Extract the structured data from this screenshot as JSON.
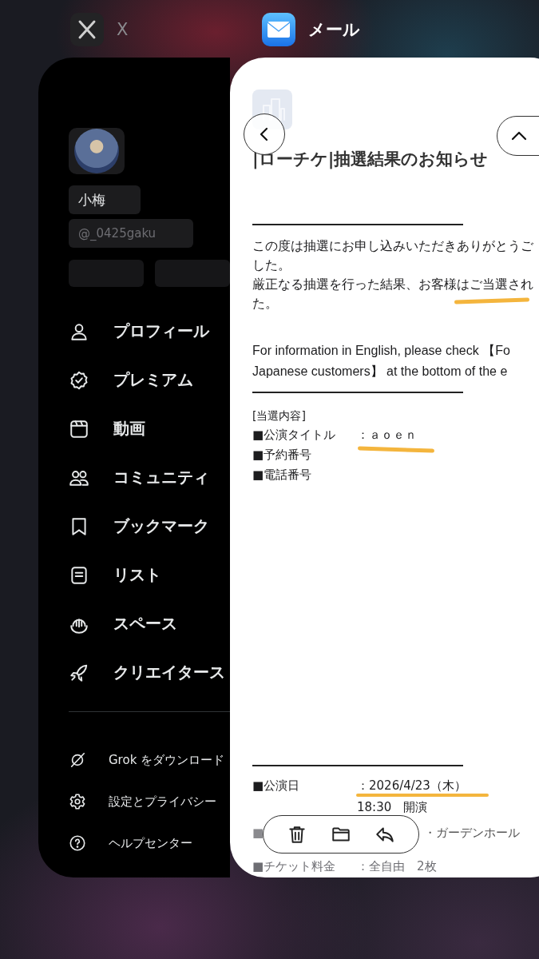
{
  "switcher_labels": [
    {
      "kind": "x",
      "name": "X"
    },
    {
      "kind": "mail",
      "name": "メール"
    }
  ],
  "x_card": {
    "profile": {
      "name": "小梅",
      "handle": "@_0425gaku"
    },
    "menu": [
      {
        "kind": "profile",
        "label": "プロフィール"
      },
      {
        "kind": "premium",
        "label": "プレミアム"
      },
      {
        "kind": "video",
        "label": "動画"
      },
      {
        "kind": "community",
        "label": "コミュニティ"
      },
      {
        "kind": "bookmark",
        "label": "ブックマーク"
      },
      {
        "kind": "list",
        "label": "リスト"
      },
      {
        "kind": "spaces",
        "label": "スペース"
      },
      {
        "kind": "creator",
        "label": "クリエイタース"
      }
    ],
    "footer_menu": [
      {
        "kind": "grok",
        "label": "Grok をダウンロード"
      },
      {
        "kind": "settings",
        "label": "設定とプライバシー"
      },
      {
        "kind": "help",
        "label": "ヘルプセンター"
      }
    ]
  },
  "mail_card": {
    "subject": "|ローチケ|抽選結果のお知らせ",
    "body": [
      "この度は抽選にお申し込みいただきありがとうご",
      "した。",
      "厳正なる抽選を行った結果、お客様はご当選され",
      "た。"
    ],
    "english": [
      "For information in English, please check 【Fo",
      "Japanese customers】 at the bottom of the e"
    ],
    "section_heading": "[当選内容]",
    "details": [
      {
        "label": "■公演タイトル",
        "value": "：ａｏｅｎ"
      },
      {
        "label": "■予約番号"
      },
      {
        "label": "■電話番号"
      }
    ],
    "schedule": [
      {
        "label": "■公演日",
        "value": "：2026/4/23（木）"
      },
      {
        "value": "18:30　開演"
      },
      {
        "label": "■",
        "value": "・ガーデンホール"
      },
      {
        "label": "■チケット料金",
        "value": "：全自由　2枚"
      }
    ],
    "toolbar": [
      {
        "kind": "delete"
      },
      {
        "kind": "folder"
      },
      {
        "kind": "reply"
      }
    ]
  }
}
